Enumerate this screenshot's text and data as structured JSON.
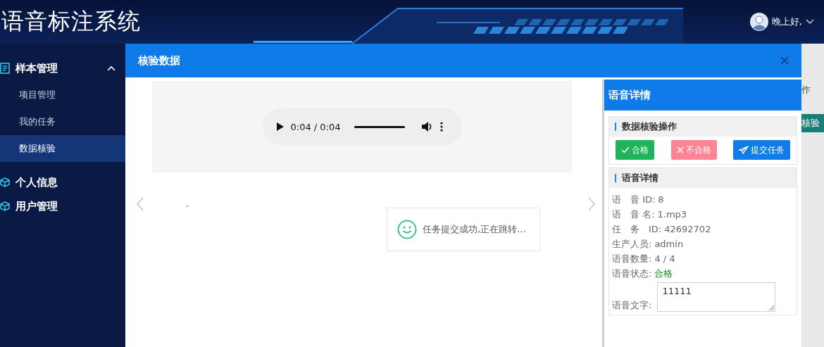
{
  "header": {
    "title": "语音标注系统",
    "greeting": "晚上好,"
  },
  "sidebar": {
    "items": [
      {
        "label": "样本管理",
        "kind": "list",
        "expanded": true,
        "children": [
          {
            "label": "项目管理",
            "selected": false
          },
          {
            "label": "我的任务",
            "selected": false
          },
          {
            "label": "数据核验",
            "selected": true
          }
        ]
      },
      {
        "label": "个人信息",
        "kind": "cube",
        "expanded": false
      },
      {
        "label": "用户管理",
        "kind": "cube",
        "expanded": false
      }
    ]
  },
  "modal": {
    "title": "核验数据",
    "audio": {
      "time": "0:04 / 0:04",
      "level": 1
    },
    "caption": ".",
    "toast": "任务提交成功,正在跳转...",
    "detail_panel": {
      "title": "语音详情",
      "actions": {
        "title": "数据核验操作",
        "buttons": [
          {
            "label": "合格",
            "kind": "pass"
          },
          {
            "label": "不合格",
            "kind": "fail"
          },
          {
            "label": "提交任务",
            "kind": "submit"
          }
        ]
      },
      "info": {
        "title": "语音详情",
        "fields": [
          {
            "label": "语　音 ID:",
            "value": "8",
            "kind": "plain"
          },
          {
            "label": "语　音 名:",
            "value": "1.mp3",
            "kind": "plain"
          },
          {
            "label": "任　务　ID:",
            "value": "42692702",
            "kind": "plain"
          },
          {
            "label": "生产人员:",
            "value": "admin",
            "kind": "plain"
          },
          {
            "label": "语音数量:",
            "value": "4 / 4",
            "kind": "plain"
          },
          {
            "label": "语音状态:",
            "value": "合格",
            "kind": "status"
          }
        ],
        "text_field": {
          "label": "语音文字:",
          "value": "11111"
        }
      }
    }
  },
  "background": {
    "fragment": "作",
    "button": "核验"
  }
}
